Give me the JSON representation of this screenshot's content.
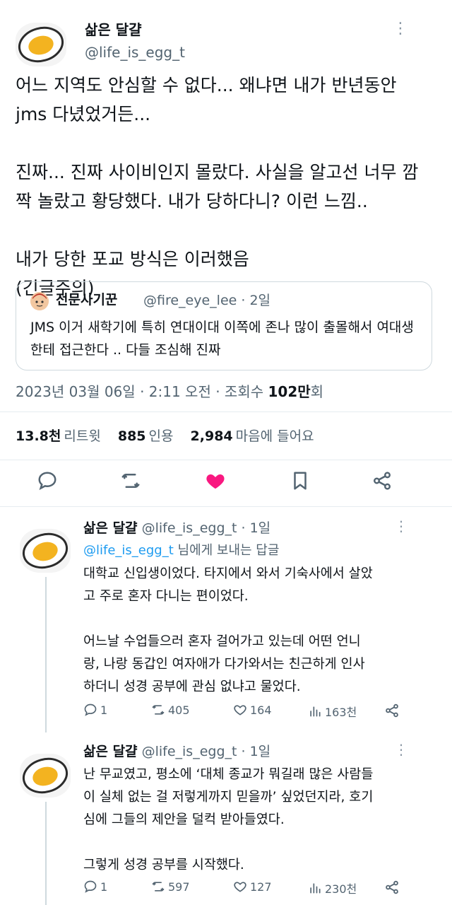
{
  "main": {
    "name": "삶은 달걀",
    "handle": "@life_is_egg_t",
    "more": "⋮",
    "body": "어느 지역도 안심할 수 없다... 왜냐면 내가 반년동안\njms 다녔었거든...\n\n진짜... 진짜 사이비인지 몰랐다. 사실을 알고선 너무 깜\n짝 놀랐고 황당했다. 내가 당하다니? 이런 느낌..\n\n내가 당한 포교 방식은 이러했음\n(긴글주의)"
  },
  "quote": {
    "name": "전문사기꾼",
    "handle": "@fire_eye_lee · 2일",
    "text": "JMS 이거 새학기에 특히 연대이대 이쪽에 존나 많이 출몰해서 여대생한테 접근한다 .. 다들 조심해 진짜"
  },
  "meta": {
    "datetime": "2023년 03월 06일 · 2:11 오전 · 조회수 ",
    "views_num": "102만",
    "views_suffix": "회"
  },
  "stats": {
    "retweets_num": "13.8천",
    "retweets_label": "리트윗",
    "quotes_num": "885",
    "quotes_label": "인용",
    "likes_num": "2,984",
    "likes_label": "마음에 들어요"
  },
  "colors": {
    "like_active": "#f91880",
    "link": "#1d9bf0",
    "muted": "#536471"
  },
  "replies": [
    {
      "name": "삶은 달걀",
      "handle": "@life_is_egg_t · 1일",
      "reply_to_handle": "@life_is_egg_t",
      "reply_to_suffix": " 님에게 보내는 답글",
      "text": "대학교 신입생이었다. 타지에서 와서 기숙사에서 살았\n고 주로 혼자 다니는 편이었다.\n\n어느날 수업들으러 혼자 걸어가고 있는데 어떤 언니\n랑, 나랑 동갑인 여자애가 다가와서는 친근하게 인사\n하더니 성경 공부에 관심 없냐고 물었다.",
      "replies": "1",
      "retweets": "405",
      "likes": "164",
      "views": "163천"
    },
    {
      "name": "삶은 달걀",
      "handle": "@life_is_egg_t · 1일",
      "text": "난 무교였고, 평소에 ‘대체 종교가 뭐길래 많은 사람들\n이 실체 없는 걸 저렇게까지 믿을까’ 싶었던지라, 호기\n심에 그들의 제안을 덜컥 받아들였다.\n\n그렇게 성경 공부를 시작했다.",
      "replies": "1",
      "retweets": "597",
      "likes": "127",
      "views": "230천"
    }
  ],
  "icons": [
    "egg-avatar",
    "more-icon",
    "reply-icon",
    "retweet-icon",
    "heart-icon",
    "bookmark-icon",
    "share-icon",
    "views-icon"
  ]
}
